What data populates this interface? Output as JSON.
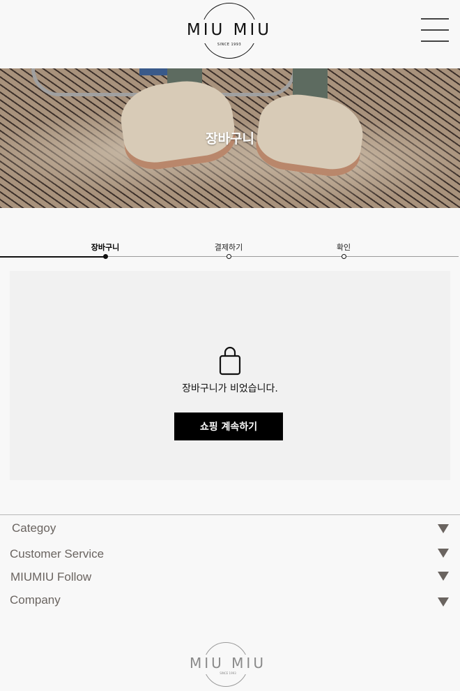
{
  "header": {
    "logo_text": "MIU MIU",
    "logo_since": "SINCE 1993",
    "menu_icon": "hamburger-menu-icon"
  },
  "hero": {
    "title": "장바구니"
  },
  "steps": [
    {
      "label": "장바구니",
      "active": true
    },
    {
      "label": "결제하기",
      "active": false
    },
    {
      "label": "확인",
      "active": false
    }
  ],
  "cart": {
    "icon": "shopping-bag-icon",
    "empty_message": "장바구니가 비었습니다.",
    "continue_button": "쇼핑 계속하기"
  },
  "footer": {
    "sections": [
      {
        "label": "Categoy",
        "icon": "triangle-down-icon"
      },
      {
        "label": "Customer Service",
        "icon": "triangle-down-icon"
      },
      {
        "label": "MIUMIU Follow",
        "icon": "triangle-down-icon"
      },
      {
        "label": "Company",
        "icon": "triangle-down-icon"
      }
    ],
    "logo_text": "MIU MIU",
    "logo_since": "SINCE 1993"
  }
}
